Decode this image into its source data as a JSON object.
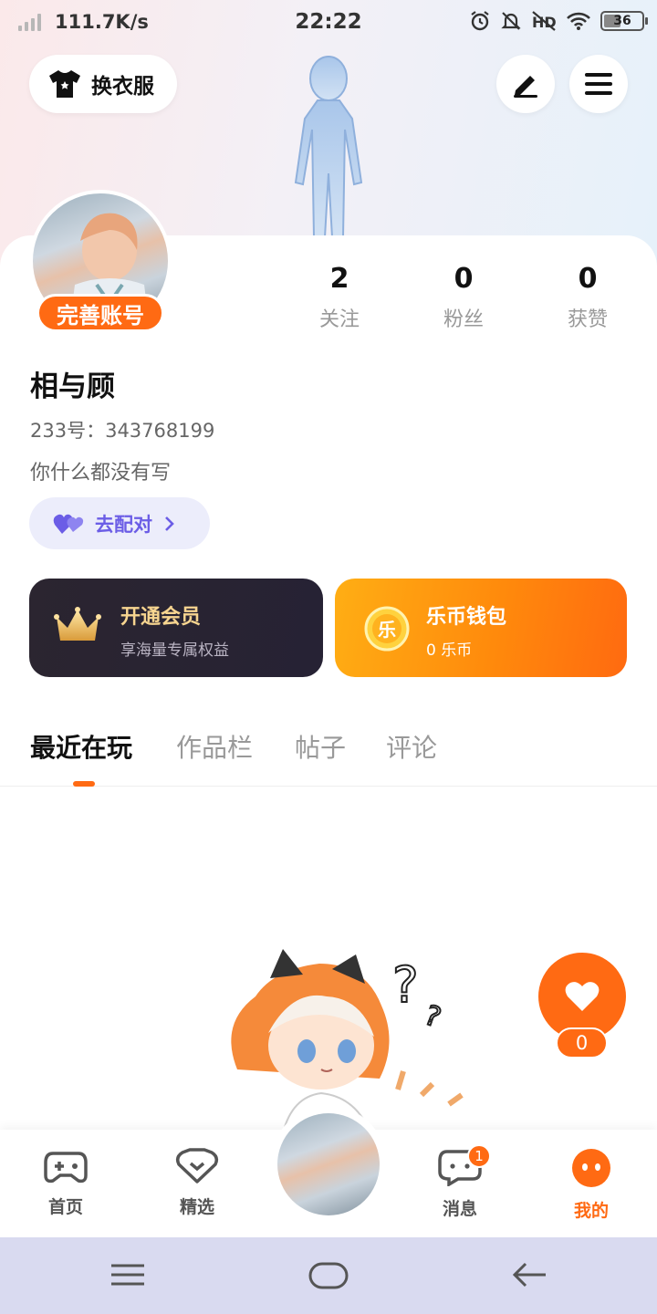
{
  "status_bar": {
    "net_speed": "111.7K/s",
    "time": "22:22",
    "battery": "36"
  },
  "header": {
    "outfit_label": "换衣服"
  },
  "profile": {
    "complete_account_label": "完善账号",
    "stats": [
      {
        "value": "2",
        "label": "关注"
      },
      {
        "value": "0",
        "label": "粉丝"
      },
      {
        "value": "0",
        "label": "获赞"
      }
    ],
    "username": "相与顾",
    "uid": "233号：343768199",
    "bio": "你什么都没有写",
    "pair_label": "去配对"
  },
  "cards": {
    "vip": {
      "title": "开通会员",
      "subtitle": "享海量专属权益",
      "title_color": "#f7d590"
    },
    "wallet": {
      "title": "乐币钱包",
      "subtitle": "0 乐币",
      "coin_glyph": "乐"
    }
  },
  "tabs": [
    {
      "label": "最近在玩",
      "active": true
    },
    {
      "label": "作品栏",
      "active": false
    },
    {
      "label": "帖子",
      "active": false
    },
    {
      "label": "评论",
      "active": false
    }
  ],
  "like": {
    "count": "0"
  },
  "bottom_nav": [
    {
      "label": "首页",
      "icon": "gamepad-icon"
    },
    {
      "label": "精选",
      "icon": "heart-chat-icon"
    },
    {
      "label": "消息",
      "icon": "message-icon",
      "badge": "1"
    },
    {
      "label": "我的",
      "icon": "face-icon",
      "active": true
    }
  ],
  "colors": {
    "accent": "#ff6a13",
    "pair": "#6b5de6"
  }
}
